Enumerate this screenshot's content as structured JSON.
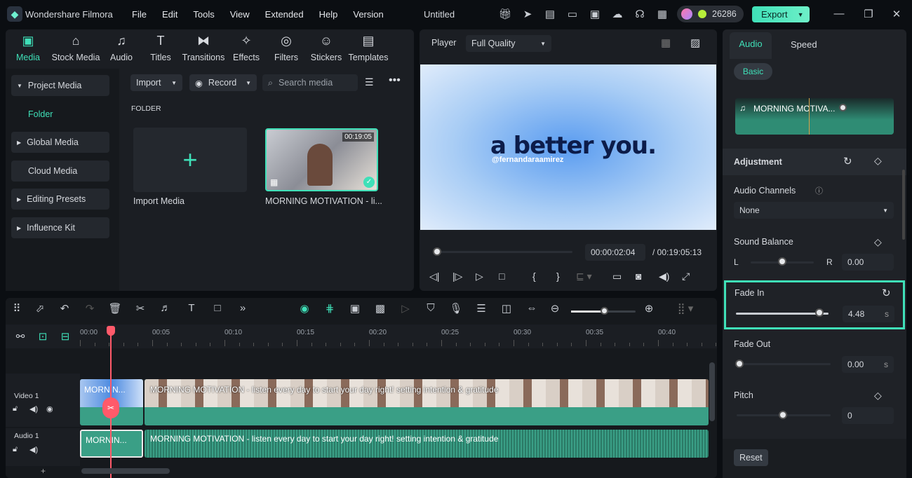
{
  "app": {
    "title": "Wondershare Filmora",
    "menu": [
      "File",
      "Edit",
      "Tools",
      "View",
      "Extended",
      "Help",
      "Version"
    ],
    "project": "Untitled",
    "credits": "26286",
    "export": "Export"
  },
  "tabs": [
    "Media",
    "Stock Media",
    "Audio",
    "Titles",
    "Transitions",
    "Effects",
    "Filters",
    "Stickers",
    "Templates"
  ],
  "sidebar": [
    "Project Media",
    "Folder",
    "Global Media",
    "Cloud Media",
    "Editing Presets",
    "Influence Kit"
  ],
  "media": {
    "import": "Import",
    "record": "Record",
    "search_placeholder": "Search media",
    "folder": "FOLDER",
    "import_media": "Import Media",
    "clip_name": "MORNING MOTIVATION - li...",
    "clip_duration": "00:19:05"
  },
  "player": {
    "label": "Player",
    "quality": "Full Quality",
    "overlay_text": "a better you.",
    "overlay_handle": "@fernandaraamirez",
    "current": "00:00:02:04",
    "total": "/ 00:19:05:13"
  },
  "right": {
    "tabs": [
      "Audio",
      "Speed"
    ],
    "basic": "Basic",
    "clip": "MORNING MOTIVA...",
    "adjustment": "Adjustment",
    "audio_channels": "Audio Channels",
    "channel_value": "None",
    "sound_balance": "Sound Balance",
    "L": "L",
    "R": "R",
    "balance_value": "0.00",
    "fade_in": "Fade In",
    "fade_in_value": "4.48",
    "fade_out": "Fade Out",
    "fade_out_value": "0.00",
    "unit": "s",
    "pitch": "Pitch",
    "pitch_value": "0",
    "reset": "Reset",
    "fade_in_fraction": 0.9
  },
  "timeline": {
    "ticks": [
      "00:00",
      "00:05",
      "00:10",
      "00:15",
      "00:20",
      "00:25",
      "00:30",
      "00:35",
      "00:40"
    ],
    "video_track": "Video 1",
    "audio_track": "Audio 1",
    "clip_short": "MORNIN...",
    "clip_title": "MORNING MOTIVATION - listen every day to start your day right! setting intention & gratitude"
  },
  "colors": {
    "accent": "#3fe0b8",
    "playhead": "#ff5a6a",
    "clip": "#3a9f86"
  }
}
